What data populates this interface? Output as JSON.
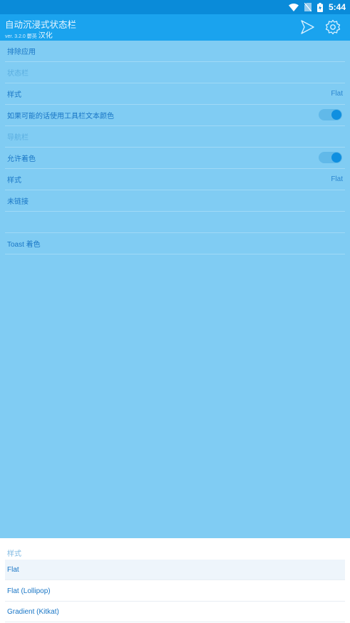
{
  "status_bar": {
    "time": "5:44"
  },
  "app_bar": {
    "title": "自动沉浸式状态栏",
    "subtitle_small": "ver. 3.2.0 鬱英",
    "subtitle_strong": "汉化",
    "icons": [
      "play-icon",
      "gear-icon"
    ]
  },
  "settings": {
    "exclude_apps": "排除应用",
    "status_bar_section": "状态栏",
    "style_label": "样式",
    "style_value": "Flat",
    "toolbar_text_color": "如果可能的话使用工具栏文本颜色",
    "toolbar_text_color_on": true,
    "nav_bar_section": "导航栏",
    "allow_tint": "允许着色",
    "allow_tint_on": true,
    "nav_style_label": "样式",
    "nav_style_value": "Flat",
    "unlinked": "未链接",
    "toast_tint": "Toast 着色"
  },
  "sheet": {
    "title": "样式",
    "options": [
      "Flat",
      "Flat (Lollipop)",
      "Gradient (Kitkat)"
    ],
    "selected": "Flat"
  },
  "colors": {
    "status_bar": "#0a8bd9",
    "app_bar": "#1aa3ee",
    "background": "#80ccf3",
    "accent": "#0f8fe0"
  }
}
